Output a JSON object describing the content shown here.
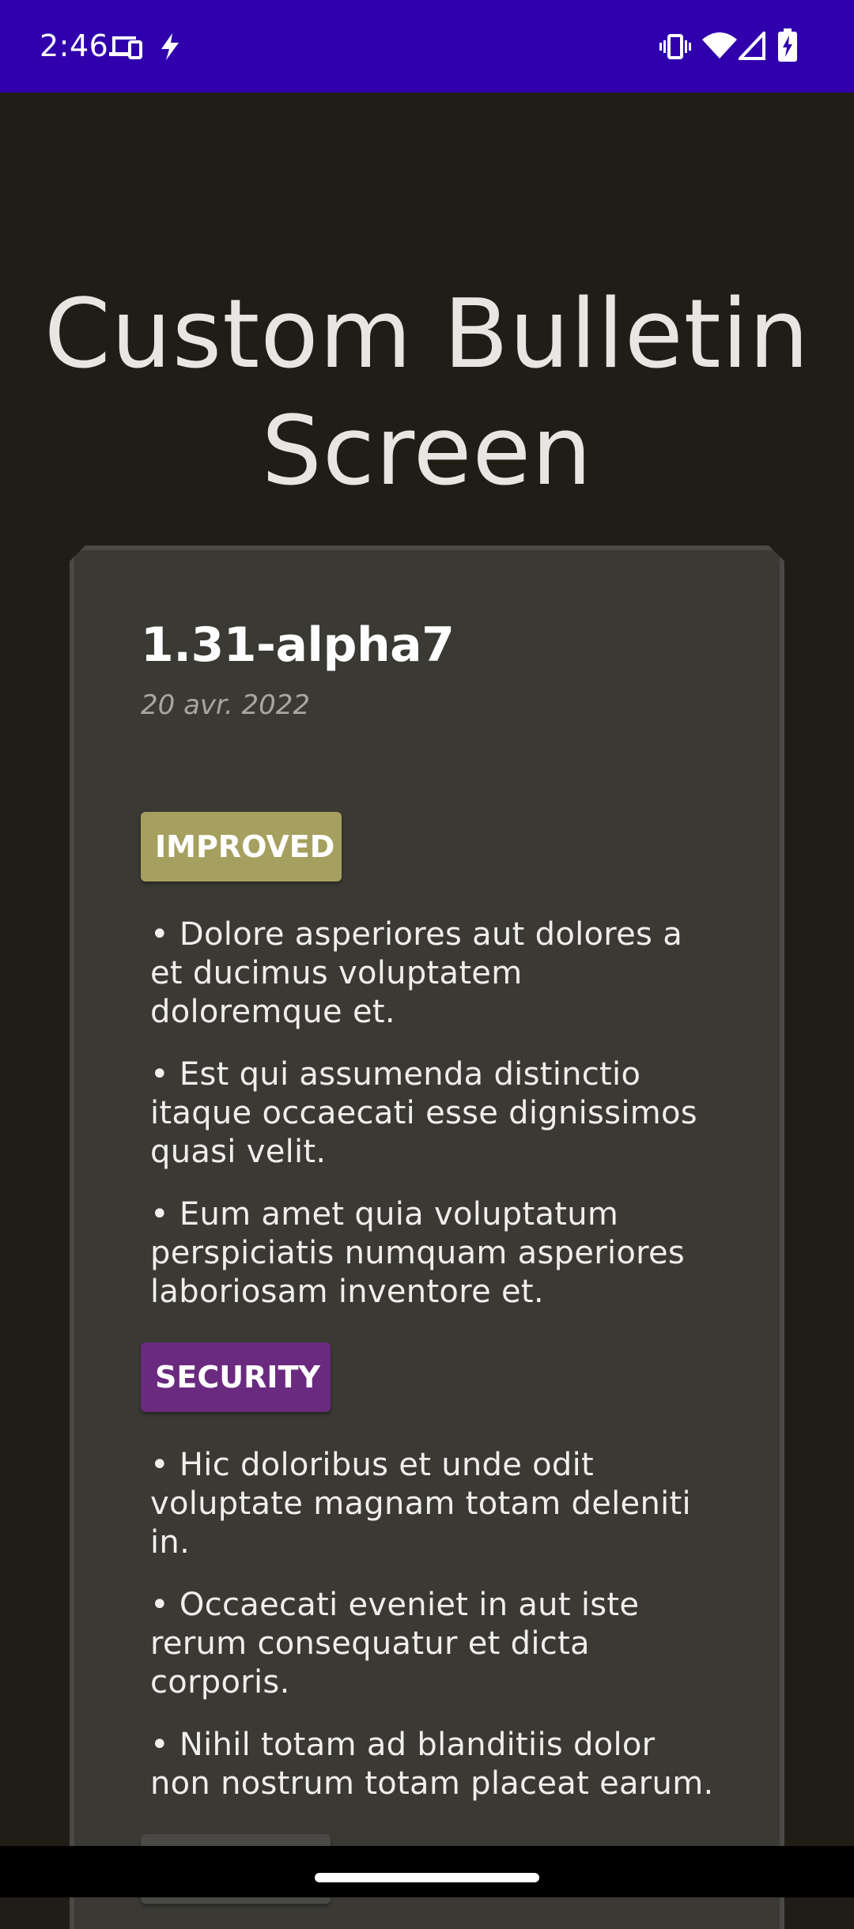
{
  "status_bar": {
    "time": "2:46",
    "left_icons": [
      "devices-icon",
      "flash-icon"
    ],
    "right_icons": [
      "vibrate-icon",
      "wifi-icon",
      "signal-icon",
      "battery-charging-icon"
    ],
    "background": "#3000ad"
  },
  "screen": {
    "title": "Custom Bulletin Screen",
    "background": "#1f1d15"
  },
  "bulletin": {
    "version": "1.31-alpha7",
    "date": "20 avr. 2022",
    "sections": [
      {
        "tag": "IMPROVED",
        "color": "#a6a060",
        "items": [
          "• Dolore asperiores aut dolores a et ducimus voluptatem doloremque et.",
          "• Est qui assumenda distinctio itaque occaecati esse dignissimos quasi velit.",
          "• Eum amet quia voluptatum perspiciatis numquam asperiores laboriosam inventore et."
        ]
      },
      {
        "tag": "SECURITY",
        "color": "#6a2a7f",
        "items": [
          "• Hic doloribus et unde odit voluptate magnam totam deleniti in.",
          "• Occaecati eveniet in aut iste rerum consequatur et dicta corporis.",
          "• Nihil totam ad blanditiis dolor non nostrum totam placeat earum."
        ]
      }
    ]
  }
}
